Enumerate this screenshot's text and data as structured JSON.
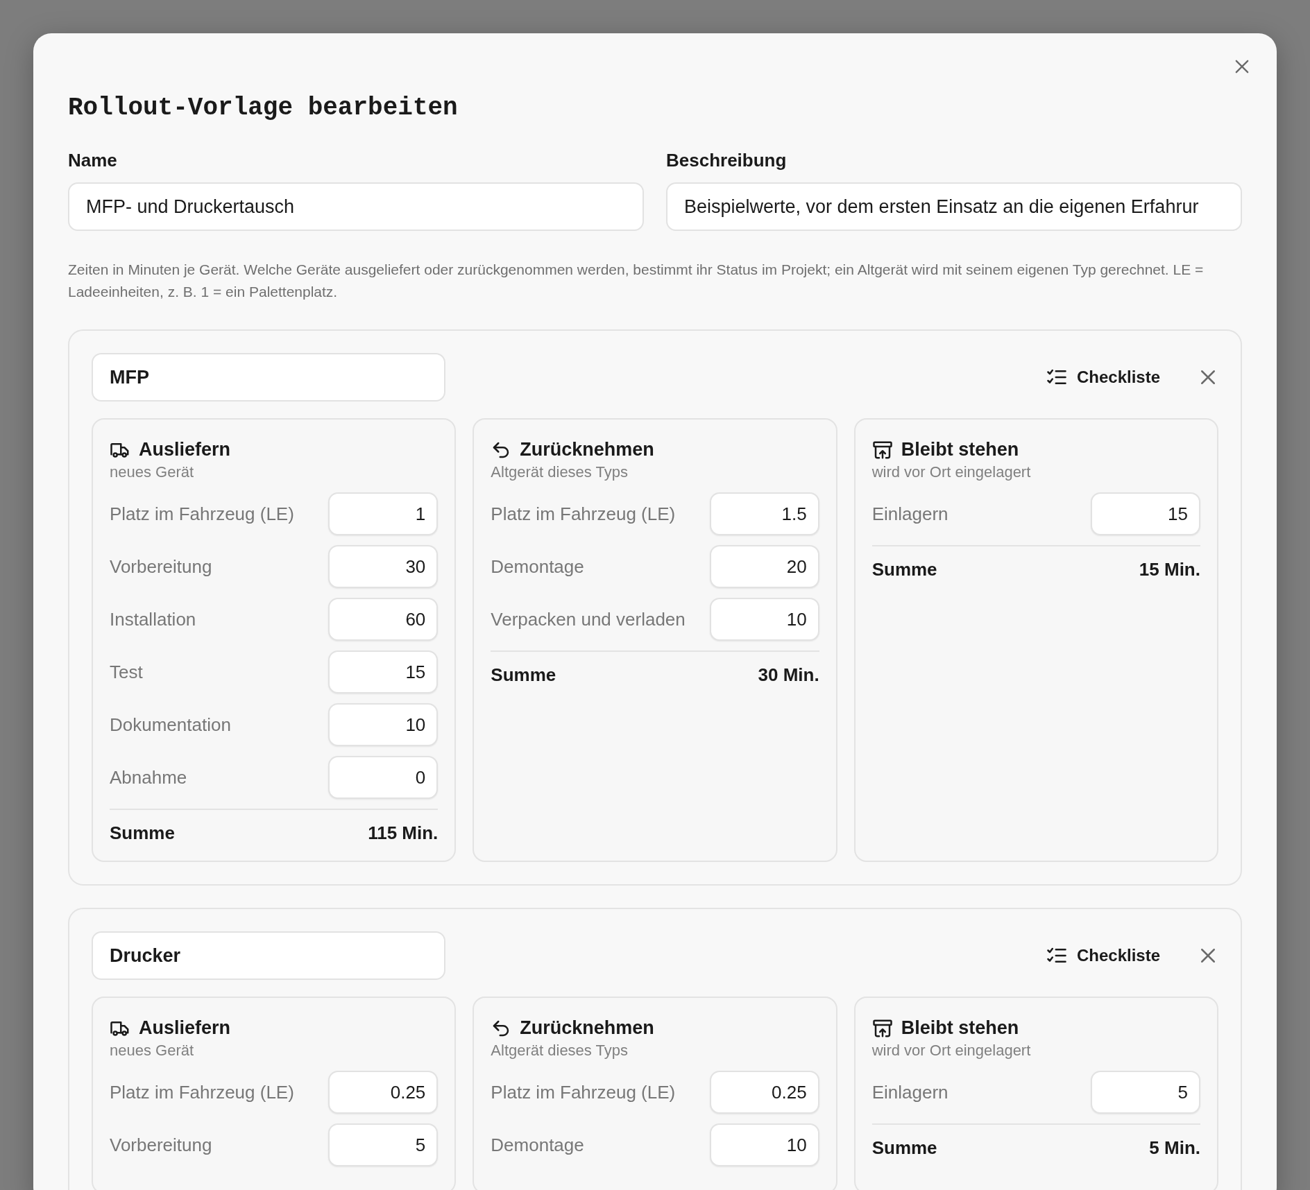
{
  "dialog": {
    "title": "Rollout-Vorlage bearbeiten"
  },
  "fields": [
    {
      "label": "Name",
      "value": "MFP- und Druckertausch"
    },
    {
      "label": "Beschreibung",
      "value": "Beispielwerte, vor dem ersten Einsatz an die eigenen Erfahrur"
    }
  ],
  "help_text": "Zeiten in Minuten je Gerät. Welche Geräte ausgeliefert oder zurückgenommen werden, bestimmt ihr Status im Projekt; ein Altgerät wird mit seinem eigenen Typ gerechnet. LE = Ladeeinheiten, z. B. 1 = ein Palettenplatz.",
  "device_types": [
    {
      "name": "MFP",
      "checklist_label": "Checkliste",
      "sections": [
        {
          "kind": "deliver",
          "title": "Ausliefern",
          "subtitle": "neues Gerät",
          "rows": [
            {
              "label": "Platz im Fahrzeug (LE)",
              "value": "1"
            },
            {
              "label": "Vorbereitung",
              "value": "30"
            },
            {
              "label": "Installation",
              "value": "60"
            },
            {
              "label": "Test",
              "value": "15"
            },
            {
              "label": "Dokumentation",
              "value": "10"
            },
            {
              "label": "Abnahme",
              "value": "0"
            }
          ],
          "total_label": "Summe",
          "total": "115 Min."
        },
        {
          "kind": "return",
          "title": "Zurücknehmen",
          "subtitle": "Altgerät dieses Typs",
          "rows": [
            {
              "label": "Platz im Fahrzeug (LE)",
              "value": "1.5"
            },
            {
              "label": "Demontage",
              "value": "20"
            },
            {
              "label": "Verpacken und verladen",
              "value": "10"
            }
          ],
          "total_label": "Summe",
          "total": "30 Min."
        },
        {
          "kind": "stay",
          "title": "Bleibt stehen",
          "subtitle": "wird vor Ort eingelagert",
          "rows": [
            {
              "label": "Einlagern",
              "value": "15"
            }
          ],
          "total_label": "Summe",
          "total": "15 Min."
        }
      ]
    },
    {
      "name": "Drucker",
      "checklist_label": "Checkliste",
      "sections": [
        {
          "kind": "deliver",
          "title": "Ausliefern",
          "subtitle": "neues Gerät",
          "rows": [
            {
              "label": "Platz im Fahrzeug (LE)",
              "value": "0.25"
            },
            {
              "label": "Vorbereitung",
              "value": "5"
            }
          ]
        },
        {
          "kind": "return",
          "title": "Zurücknehmen",
          "subtitle": "Altgerät dieses Typs",
          "rows": [
            {
              "label": "Platz im Fahrzeug (LE)",
              "value": "0.25"
            },
            {
              "label": "Demontage",
              "value": "10"
            }
          ]
        },
        {
          "kind": "stay",
          "title": "Bleibt stehen",
          "subtitle": "wird vor Ort eingelagert",
          "rows": [
            {
              "label": "Einlagern",
              "value": "5"
            }
          ],
          "total_label": "Summe",
          "total": "5 Min."
        }
      ]
    }
  ]
}
